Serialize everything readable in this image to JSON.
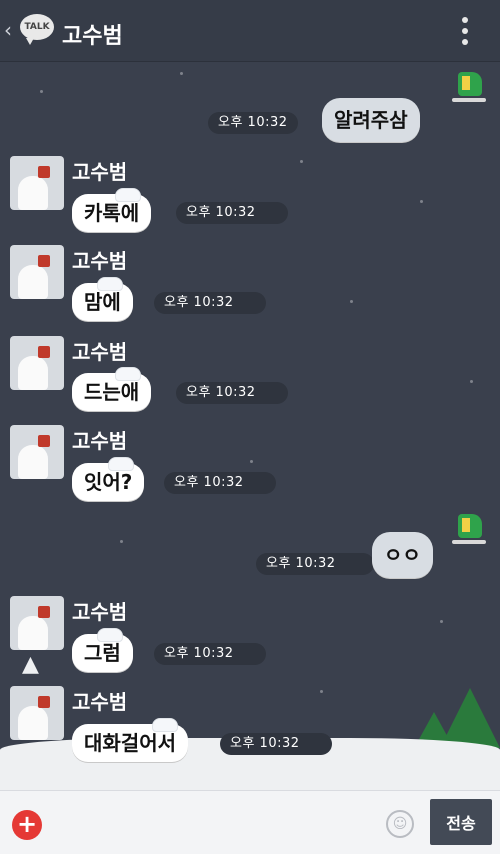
{
  "header": {
    "back_icon": "‹",
    "logo_text": "TALK",
    "title": "고수범",
    "menu_icon": "kebab-menu-icon"
  },
  "messages": [
    {
      "from": "me",
      "text": "알려주삼",
      "time": "오후 10:32"
    },
    {
      "from": "other",
      "sender": "고수범",
      "text": "카톡에",
      "time": "오후 10:32"
    },
    {
      "from": "other",
      "sender": "고수범",
      "text": "맘에",
      "time": "오후 10:32"
    },
    {
      "from": "other",
      "sender": "고수범",
      "text": "드는애",
      "time": "오후 10:32"
    },
    {
      "from": "other",
      "sender": "고수범",
      "text": "잇어?",
      "time": "오후 10:32"
    },
    {
      "from": "me",
      "text": "ㅇㅇ",
      "time": "오후 10:32"
    },
    {
      "from": "other",
      "sender": "고수범",
      "text": "그럼",
      "time": "오후 10:32"
    },
    {
      "from": "other",
      "sender": "고수범",
      "text": "대화걸어서",
      "time": "오후 10:32"
    }
  ],
  "input": {
    "placeholder": "",
    "send_label": "전송",
    "plus_label": "+",
    "emoji_label": "☺"
  },
  "colors": {
    "background": "#3a404d",
    "accent": "#e53935",
    "send_button": "#434a56"
  }
}
